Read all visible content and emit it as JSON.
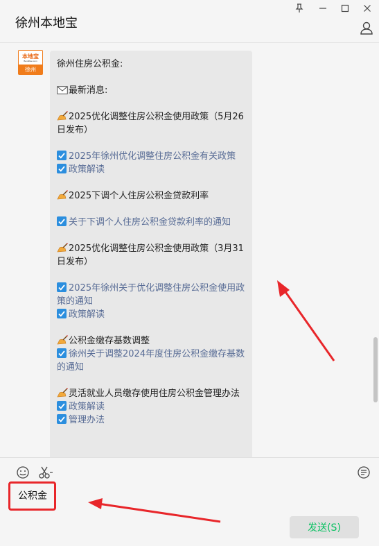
{
  "window": {
    "title": "徐州本地宝",
    "controls": [
      "pin-icon",
      "minimize-icon",
      "maximize-icon",
      "close-icon"
    ]
  },
  "message": {
    "avatar": {
      "top_text": "本地宝",
      "small_text": "Bendibao.com",
      "bottom_text": "徐州"
    },
    "lines": [
      {
        "type": "text",
        "text": "徐州住房公积金:"
      },
      {
        "type": "gap"
      },
      {
        "type": "text",
        "icon": "envelope-icon",
        "text": "最新消息:"
      },
      {
        "type": "gap"
      },
      {
        "type": "text",
        "icon": "writing-hand-icon",
        "text": "2025优化调整住房公积金使用政策（5月26日发布）"
      },
      {
        "type": "gap"
      },
      {
        "type": "link",
        "text": "2025年徐州优化调整住房公积金有关政策"
      },
      {
        "type": "link",
        "text": "政策解读"
      },
      {
        "type": "gap"
      },
      {
        "type": "text",
        "icon": "writing-hand-icon",
        "text": "2025下调个人住房公积金贷款利率"
      },
      {
        "type": "gap"
      },
      {
        "type": "link",
        "text": "关于下调个人住房公积金贷款利率的通知"
      },
      {
        "type": "gap"
      },
      {
        "type": "text",
        "icon": "writing-hand-icon",
        "text": "2025优化调整住房公积金使用政策（3月31日发布）"
      },
      {
        "type": "gap"
      },
      {
        "type": "link",
        "text": "2025年徐州关于优化调整住房公积金使用政策的通知"
      },
      {
        "type": "link",
        "text": "政策解读"
      },
      {
        "type": "gap"
      },
      {
        "type": "text",
        "icon": "writing-hand-icon",
        "text": "公积金缴存基数调整"
      },
      {
        "type": "link",
        "text": "徐州关于调整2024年度住房公积金缴存基数的通知"
      },
      {
        "type": "gap"
      },
      {
        "type": "text",
        "icon": "writing-hand-icon",
        "text": "灵活就业人员缴存使用住房公积金管理办法"
      },
      {
        "type": "link",
        "text": "政策解读"
      },
      {
        "type": "link",
        "text": "管理办法"
      }
    ]
  },
  "input": {
    "value": "公积金",
    "tools": [
      "emoji-icon",
      "scissors-icon",
      "chat-history-icon"
    ],
    "send_label": "发送(S)"
  },
  "colors": {
    "link": "#576b95",
    "checkbox": "#2b8ede",
    "send_text": "#07c160",
    "annotation": "#e8262a"
  }
}
